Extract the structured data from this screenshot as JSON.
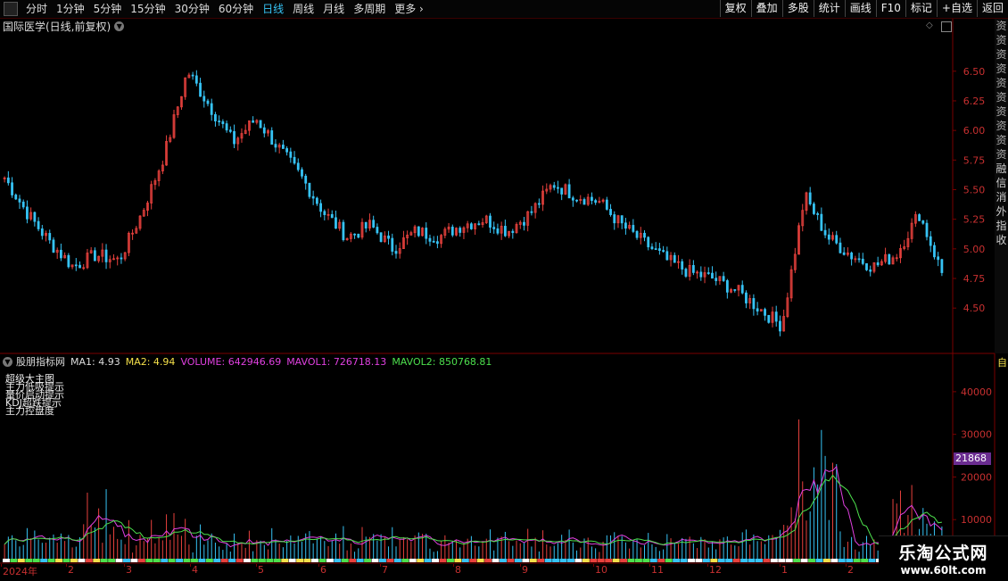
{
  "toolbar": {
    "periods": [
      "分时",
      "1分钟",
      "5分钟",
      "15分钟",
      "30分钟",
      "60分钟",
      "日线",
      "周线",
      "月线",
      "多周期",
      "更多"
    ],
    "active_period": "日线",
    "right_buttons": [
      "复权",
      "叠加",
      "多股",
      "统计",
      "画线",
      "F10",
      "标记",
      "+自选",
      "返回"
    ]
  },
  "main_chart": {
    "title": "国际医学(日线,前复权)",
    "price_ticks": [
      "6.50",
      "6.25",
      "6.00",
      "5.75",
      "5.50",
      "5.25",
      "5.00",
      "4.75",
      "4.50"
    ],
    "sidebar_text": [
      "资",
      "资",
      "资",
      "资",
      "资",
      "资",
      "资",
      "资",
      "资",
      "资",
      "融",
      "信",
      "消",
      "外",
      "指",
      "收"
    ]
  },
  "sub_chart": {
    "name": "股朋指标网",
    "ma1_label": "MA1: 4.93",
    "ma2_label": "MA2: 4.94",
    "volume_label": "VOLUME: 642946.69",
    "mavol1_label": "MAVOL1: 726718.13",
    "mavol2_label": "MAVOL2: 850768.81",
    "legend_lines": [
      "超级大主图",
      "主力低吸提示",
      "量价启动提示",
      "KDJ超跌提示",
      "主力控盘度"
    ],
    "vol_ticks": [
      "40000",
      "30000",
      "20000",
      "10000"
    ],
    "current_value": "21868",
    "sidebar_char": "自"
  },
  "colors": {
    "up": "#e8413d",
    "down": "#36c3f5",
    "mavol1": "#e040e0",
    "mavol2": "#4de04d",
    "axis": "#7a0000"
  },
  "date_axis": {
    "labels": [
      "2024年",
      "2",
      "3",
      "4",
      "5",
      "6",
      "7",
      "8",
      "9",
      "10",
      "11",
      "12",
      "1",
      "2"
    ]
  },
  "watermark": {
    "title": "乐淘公式网",
    "url": "www.60lt.com"
  },
  "chart_data": {
    "type": "candlestick",
    "price_axis": {
      "ylim": [
        4.2,
        6.8
      ],
      "ticks": [
        6.5,
        6.25,
        6.0,
        5.75,
        5.5,
        5.25,
        5.0,
        4.75,
        4.5
      ]
    },
    "volume_axis": {
      "ylim": [
        0,
        45000
      ],
      "ticks": [
        40000,
        30000,
        20000,
        10000
      ]
    },
    "x_months": [
      "2024年",
      "2",
      "3",
      "4",
      "5",
      "6",
      "7",
      "8",
      "9",
      "10",
      "11",
      "12",
      "1",
      "2"
    ],
    "price_close_path": [
      5.6,
      5.3,
      5.05,
      4.85,
      4.95,
      4.9,
      5.3,
      5.8,
      6.5,
      6.2,
      5.9,
      6.1,
      5.85,
      5.6,
      5.3,
      5.1,
      5.2,
      5.0,
      5.15,
      5.1,
      5.2,
      5.25,
      5.15,
      5.3,
      5.55,
      5.45,
      5.4,
      5.2,
      5.05,
      4.9,
      4.8,
      4.75,
      4.65,
      4.5,
      4.35,
      5.45,
      5.1,
      4.95,
      4.85,
      4.95,
      5.3,
      4.8
    ],
    "volume_mavol1_peak": 22000,
    "volume_mavol2_peak": 19000
  }
}
